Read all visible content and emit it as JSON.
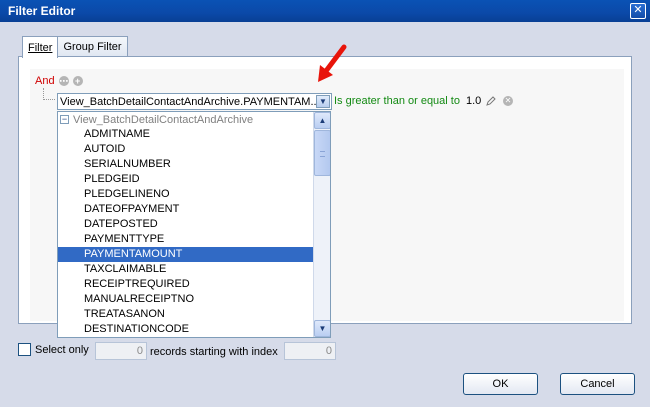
{
  "window": {
    "title": "Filter Editor",
    "close_glyph": "✕"
  },
  "tabs": [
    {
      "label": "Filter",
      "active": true
    },
    {
      "label": "Group Filter",
      "active": false
    }
  ],
  "condition": {
    "group_operator": "And",
    "field": "View_BatchDetailContactAndArchive.PAYMENTAM...",
    "operator": "Is greater than or equal to",
    "value": "1.0"
  },
  "dropdown": {
    "group_header": "View_BatchDetailContactAndArchive",
    "items": [
      "ADMITNAME",
      "AUTOID",
      "SERIALNUMBER",
      "PLEDGEID",
      "PLEDGELINENO",
      "DATEOFPAYMENT",
      "DATEPOSTED",
      "PAYMENTTYPE",
      "PAYMENTAMOUNT",
      "TAXCLAIMABLE",
      "RECEIPTREQUIRED",
      "MANUALRECEIPTNO",
      "TREATASANON",
      "DESTINATIONCODE"
    ],
    "selected": "PAYMENTAMOUNT"
  },
  "footer": {
    "select_only_label": "Select only",
    "count_value": "0",
    "records_label": "records starting with index",
    "index_value": "0",
    "ok_label": "OK",
    "cancel_label": "Cancel"
  },
  "colors": {
    "group_operator": "#d00000",
    "operator": "#138a13",
    "selection": "#316ac5",
    "annotation_arrow": "#e8140a",
    "titlebar": "#0b49a8"
  },
  "icons": {
    "title_close": "close-icon",
    "group_options": "ellipsis-icon",
    "add_condition": "plus-icon",
    "edit_value": "pencil-icon",
    "remove_condition": "remove-icon",
    "annotation": "red-arrow-icon"
  }
}
